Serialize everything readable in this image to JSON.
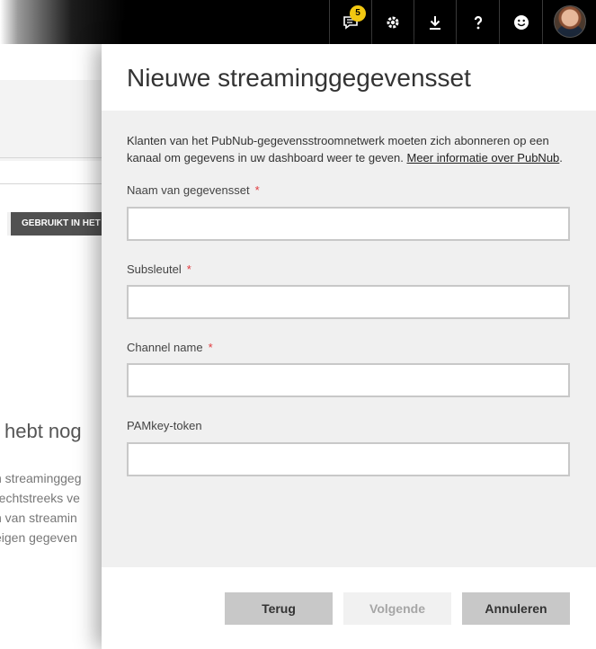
{
  "topbar": {
    "notification_count": "5",
    "icons": [
      "notifications-icon",
      "gear-icon",
      "download-icon",
      "help-icon",
      "smiley-icon",
      "avatar"
    ]
  },
  "background": {
    "column_header": "GEBRUIKT IN HET",
    "empty_heading": "l hebt nog",
    "empty_lines": [
      "n streaminggeg",
      "rechtstreeks ve",
      "n van streamin",
      "eigen gegeven"
    ]
  },
  "panel": {
    "title": "Nieuwe streaminggegevensset",
    "intro_text": "Klanten van het PubNub-gegevensstroomnetwerk moeten zich abonneren op een kanaal om gegevens in uw dashboard weer te geven. ",
    "intro_link": "Meer informatie over PubNub",
    "intro_end": ".",
    "fields": [
      {
        "label": "Naam van gegevensset",
        "required": "*",
        "value": ""
      },
      {
        "label": "Subsleutel",
        "required": "*",
        "value": ""
      },
      {
        "label": "Channel name",
        "required": "*",
        "value": ""
      },
      {
        "label": "PAMkey-token",
        "required": "",
        "value": ""
      }
    ],
    "buttons": {
      "back": "Terug",
      "next": "Volgende",
      "cancel": "Annuleren"
    }
  },
  "colors": {
    "accent_badge": "#f2c811",
    "required_star": "#e03a3e",
    "topbar": "#000000",
    "panel_body": "#f0f0f0"
  }
}
